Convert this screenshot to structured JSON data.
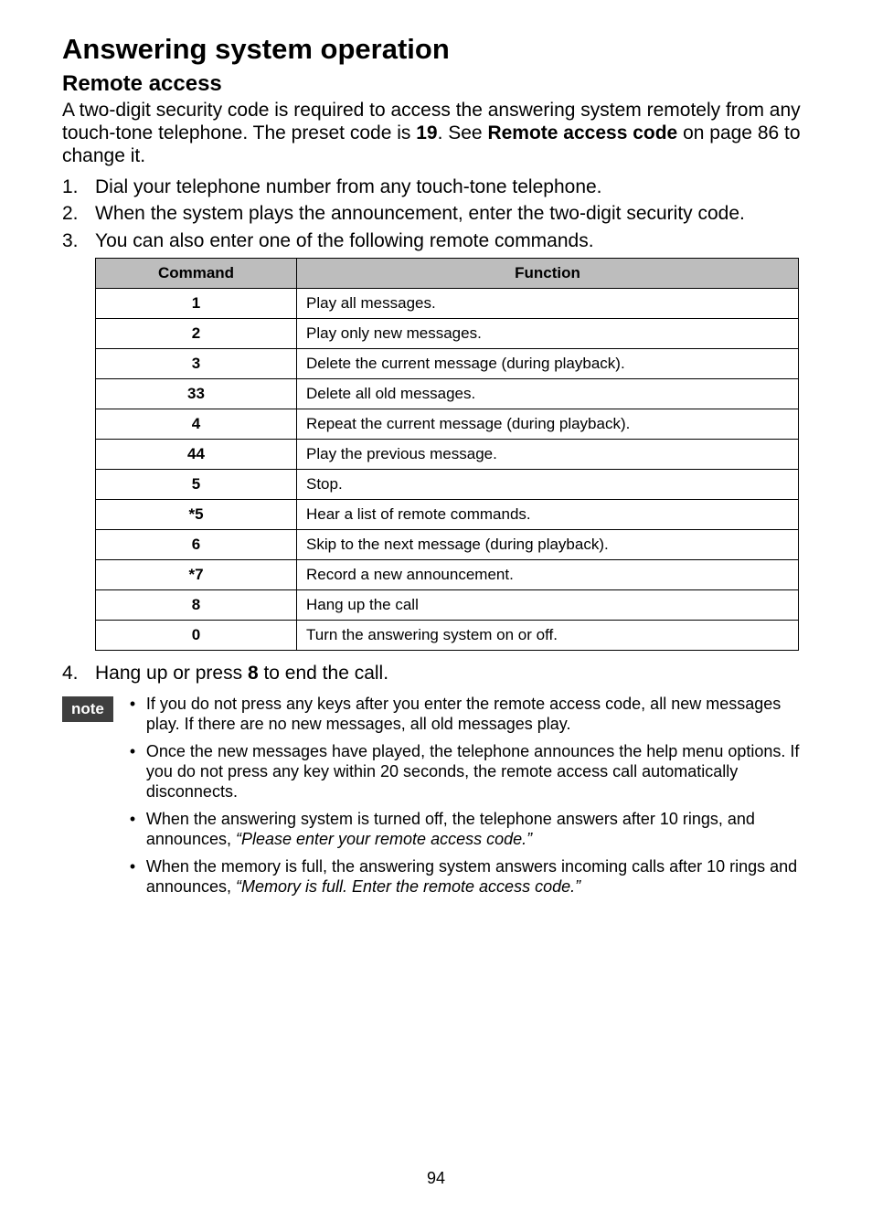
{
  "h1": "Answering system operation",
  "h2": "Remote access",
  "intro_a": "A two-digit security code is required to access the answering system remotely from any touch-tone telephone. The preset code is ",
  "intro_code": "19",
  "intro_b": ". See ",
  "intro_ref": "Remote access code",
  "intro_c": " on page 86 to change it.",
  "steps": [
    "Dial your telephone number from any touch-tone telephone.",
    "When the system plays the announcement, enter the two-digit security code.",
    "You can also enter one of the following remote commands."
  ],
  "table_headers": [
    "Command",
    "Function"
  ],
  "table_rows": [
    {
      "cmd": "1",
      "fn": "Play all messages."
    },
    {
      "cmd": "2",
      "fn": "Play only new messages."
    },
    {
      "cmd": "3",
      "fn": "Delete the current message (during playback)."
    },
    {
      "cmd": "33",
      "fn": "Delete all old messages."
    },
    {
      "cmd": "4",
      "fn": "Repeat the current message (during playback)."
    },
    {
      "cmd": "44",
      "fn": "Play the previous message."
    },
    {
      "cmd": "5",
      "fn": "Stop."
    },
    {
      "cmd": "*5",
      "fn": "Hear a list of remote commands."
    },
    {
      "cmd": "6",
      "fn": "Skip to the next message (during playback)."
    },
    {
      "cmd": "*7",
      "fn": "Record a new announcement."
    },
    {
      "cmd": "8",
      "fn": "Hang up the call"
    },
    {
      "cmd": "0",
      "fn": "Turn the answering system on or off."
    }
  ],
  "step4_a": "Hang up or press ",
  "step4_key": "8",
  "step4_b": " to end the call.",
  "note_label": "note",
  "notes": {
    "n1": "If you do not press any keys after you enter the remote access code, all new messages play. If there are no new messages, all old messages play.",
    "n2": "Once the new messages have played, the telephone announces the help menu options. If you do not press any key within 20 seconds, the remote access call automatically disconnects.",
    "n3_a": "When the answering system is turned off, the telephone answers after 10 rings, and announces, ",
    "n3_i": "“Please enter your remote access code.”",
    "n4_a": "When the memory is full, the answering system answers incoming calls after 10 rings and announces, ",
    "n4_i": "“Memory is full. Enter the remote access code.”"
  },
  "page_number": "94"
}
